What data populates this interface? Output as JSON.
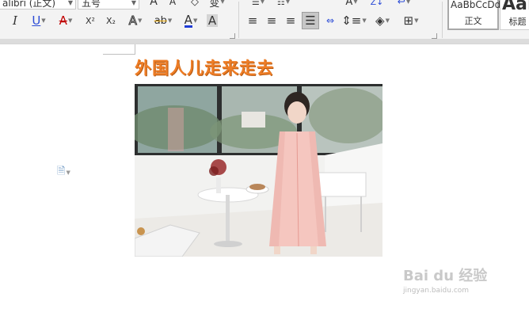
{
  "ribbon": {
    "font_name": "alibri (正文)",
    "font_size": "五号",
    "row1": {
      "grow": "A",
      "shrink": "A",
      "clear": "A",
      "pinyin": "变"
    },
    "row2": {
      "italic": "I",
      "underline": "U",
      "strike": "A",
      "superscript": "X²",
      "subscript": "X₂",
      "text_effect": "A",
      "highlight": "ab",
      "font_color": "A",
      "char_shading": "A"
    },
    "para_row1": {
      "a": "A",
      "b": "Z↓"
    },
    "styles": [
      {
        "sample": "AaBbCcDd",
        "name": "正文"
      },
      {
        "sample": "AaB",
        "name": "标题"
      }
    ],
    "colors": {
      "accent_red": "#c00000",
      "accent_blue": "#1f3cd6",
      "active_bg": "#c7c7c7"
    }
  },
  "document": {
    "title": "外国人儿走来走去",
    "title_color": "#ee7d26"
  },
  "watermark": {
    "main": "Bai du 经验",
    "sub": "jingyan.baidu.com"
  }
}
